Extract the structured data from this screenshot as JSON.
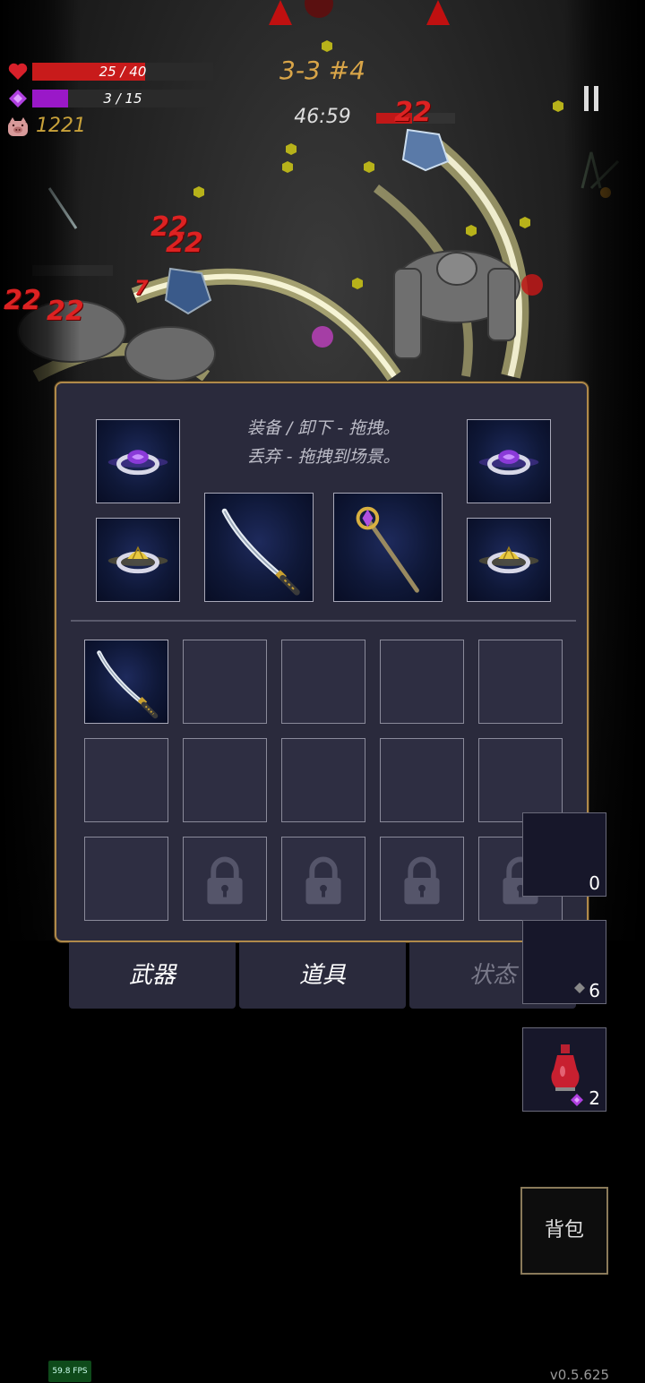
{
  "hud": {
    "hp_text": "25 / 40",
    "hp_fraction": 0.625,
    "mp_text": "3 / 15",
    "mp_fraction": 0.2,
    "gold": "1221",
    "stage": "3-3 #4",
    "timer": "46:59"
  },
  "damage_numbers": [
    "22",
    "22",
    "22",
    "22",
    "7",
    "22"
  ],
  "inventory": {
    "hint_line1": "装备 / 卸下 - 拖拽。",
    "hint_line2": "丢弃 - 拖拽到场景。",
    "equipped": [
      {
        "slot": "ring-top-left",
        "item": "purple-ring"
      },
      {
        "slot": "ring-bottom-left",
        "item": "gold-ring"
      },
      {
        "slot": "weapon-1",
        "item": "katana"
      },
      {
        "slot": "weapon-2",
        "item": "staff"
      },
      {
        "slot": "ring-top-right",
        "item": "purple-ring"
      },
      {
        "slot": "ring-bottom-right",
        "item": "gold-ring"
      }
    ],
    "grid": [
      [
        "katana",
        "",
        "",
        "",
        ""
      ],
      [
        "",
        "",
        "",
        "",
        ""
      ],
      [
        "",
        "locked",
        "locked",
        "locked",
        "locked"
      ]
    ]
  },
  "tabs": [
    {
      "label": "武器",
      "active": true
    },
    {
      "label": "道具",
      "active": true
    },
    {
      "label": "状态",
      "active": false
    }
  ],
  "side_items": [
    {
      "count": "0"
    },
    {
      "count": "6"
    },
    {
      "count": "2",
      "icon": "red-potion-icon"
    }
  ],
  "backpack_label": "背包",
  "fps": "59.8 FPS",
  "version": "v0.5.625",
  "colors": {
    "hp": "#c81b1b",
    "mp": "#9a18c8",
    "panel_border": "#b08a4a",
    "stage_text": "#d9a548"
  }
}
